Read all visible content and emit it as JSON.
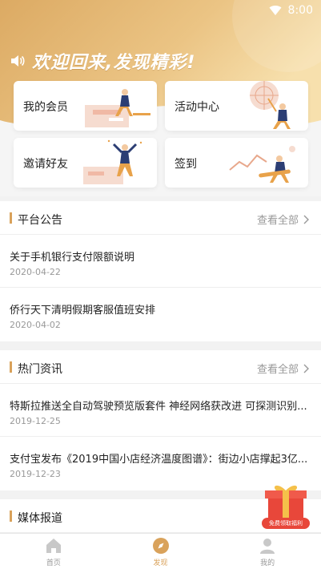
{
  "status_bar": {
    "time": "8:00",
    "wifi_icon": "wifi-icon"
  },
  "welcome_text": "欢迎回来,发现精彩!",
  "colors": {
    "accent": "#d9a25b",
    "hero_start": "#e0b06a",
    "hero_end": "#f6dfaa",
    "gift_red": "#e8473a"
  },
  "cards": [
    {
      "label": "我的会员"
    },
    {
      "label": "活动中心"
    },
    {
      "label": "邀请好友"
    },
    {
      "label": "签到"
    }
  ],
  "notice": {
    "title": "平台公告",
    "more": "查看全部",
    "items": [
      {
        "title": "关于手机银行支付限额说明",
        "date": "2020-04-22"
      },
      {
        "title": "侨行天下清明假期客服值班安排",
        "date": "2020-04-02"
      }
    ]
  },
  "news": {
    "title": "热门资讯",
    "more": "查看全部",
    "items": [
      {
        "title": "特斯拉推送全自动驾驶预览版套件 神经网络获改进 可探测识别...",
        "date": "2019-12-25"
      },
      {
        "title": "支付宝发布《2019中国小店经济温度图谱》：街边小店撑起3亿...",
        "date": "2019-12-23"
      }
    ]
  },
  "media": {
    "title": "媒体报道"
  },
  "gift": {
    "caption": "免费领取福利",
    "icon": "gift-box-icon"
  },
  "tabs": [
    {
      "label": "首页",
      "icon": "home-icon"
    },
    {
      "label": "发现",
      "icon": "compass-icon",
      "active": true
    },
    {
      "label": "我的",
      "icon": "user-icon"
    }
  ]
}
